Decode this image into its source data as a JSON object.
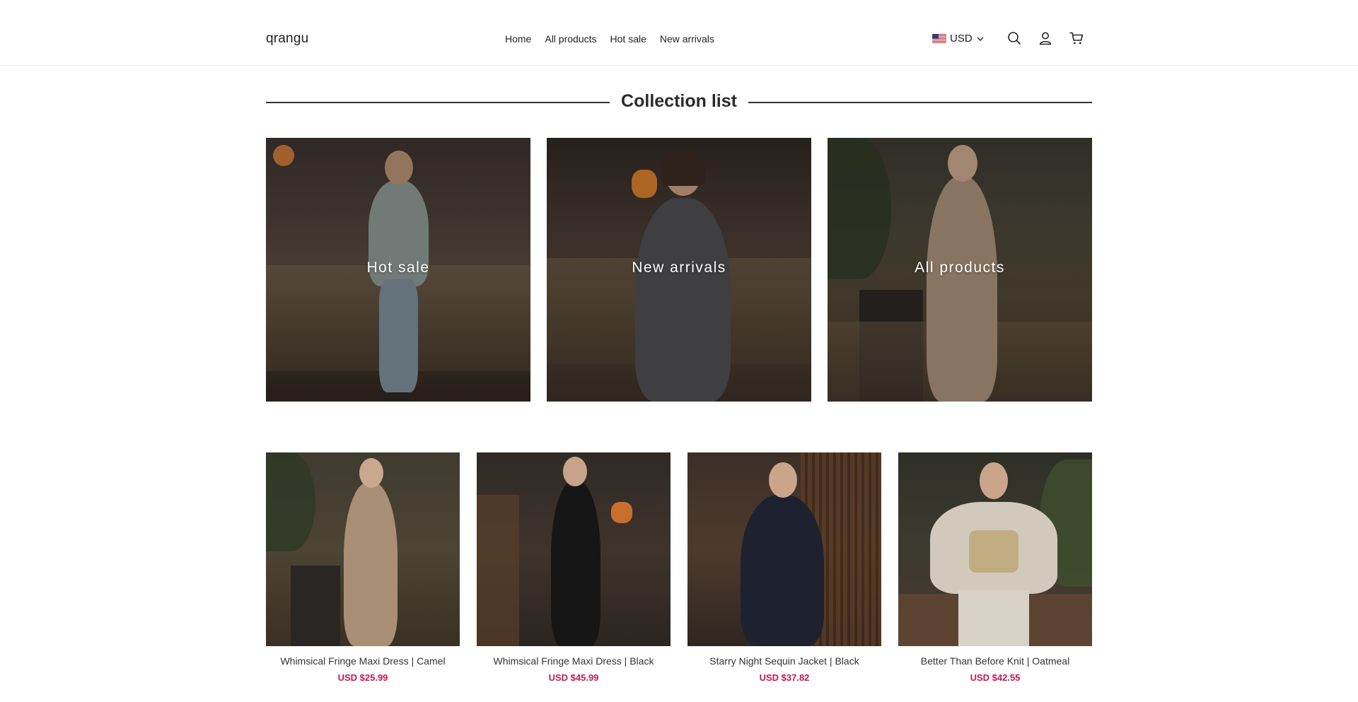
{
  "header": {
    "logo": "qrangu",
    "nav": [
      "Home",
      "All products",
      "Hot sale",
      "New arrivals"
    ],
    "currency": "USD",
    "icons": [
      "search-icon",
      "account-icon",
      "cart-icon"
    ]
  },
  "section": {
    "title": "Collection list"
  },
  "collections": [
    {
      "label": "Hot sale"
    },
    {
      "label": "New arrivals"
    },
    {
      "label": "All products"
    }
  ],
  "products": [
    {
      "name": "Whimsical Fringe Maxi Dress | Camel",
      "price": "USD $25.99"
    },
    {
      "name": "Whimsical Fringe Maxi Dress | Black",
      "price": "USD $45.99"
    },
    {
      "name": "Starry Night Sequin Jacket | Black",
      "price": "USD $37.82"
    },
    {
      "name": "Better Than Before Knit | Oatmeal",
      "price": "USD $42.55"
    }
  ],
  "colors": {
    "price": "#c2185b",
    "text": "#222222"
  }
}
